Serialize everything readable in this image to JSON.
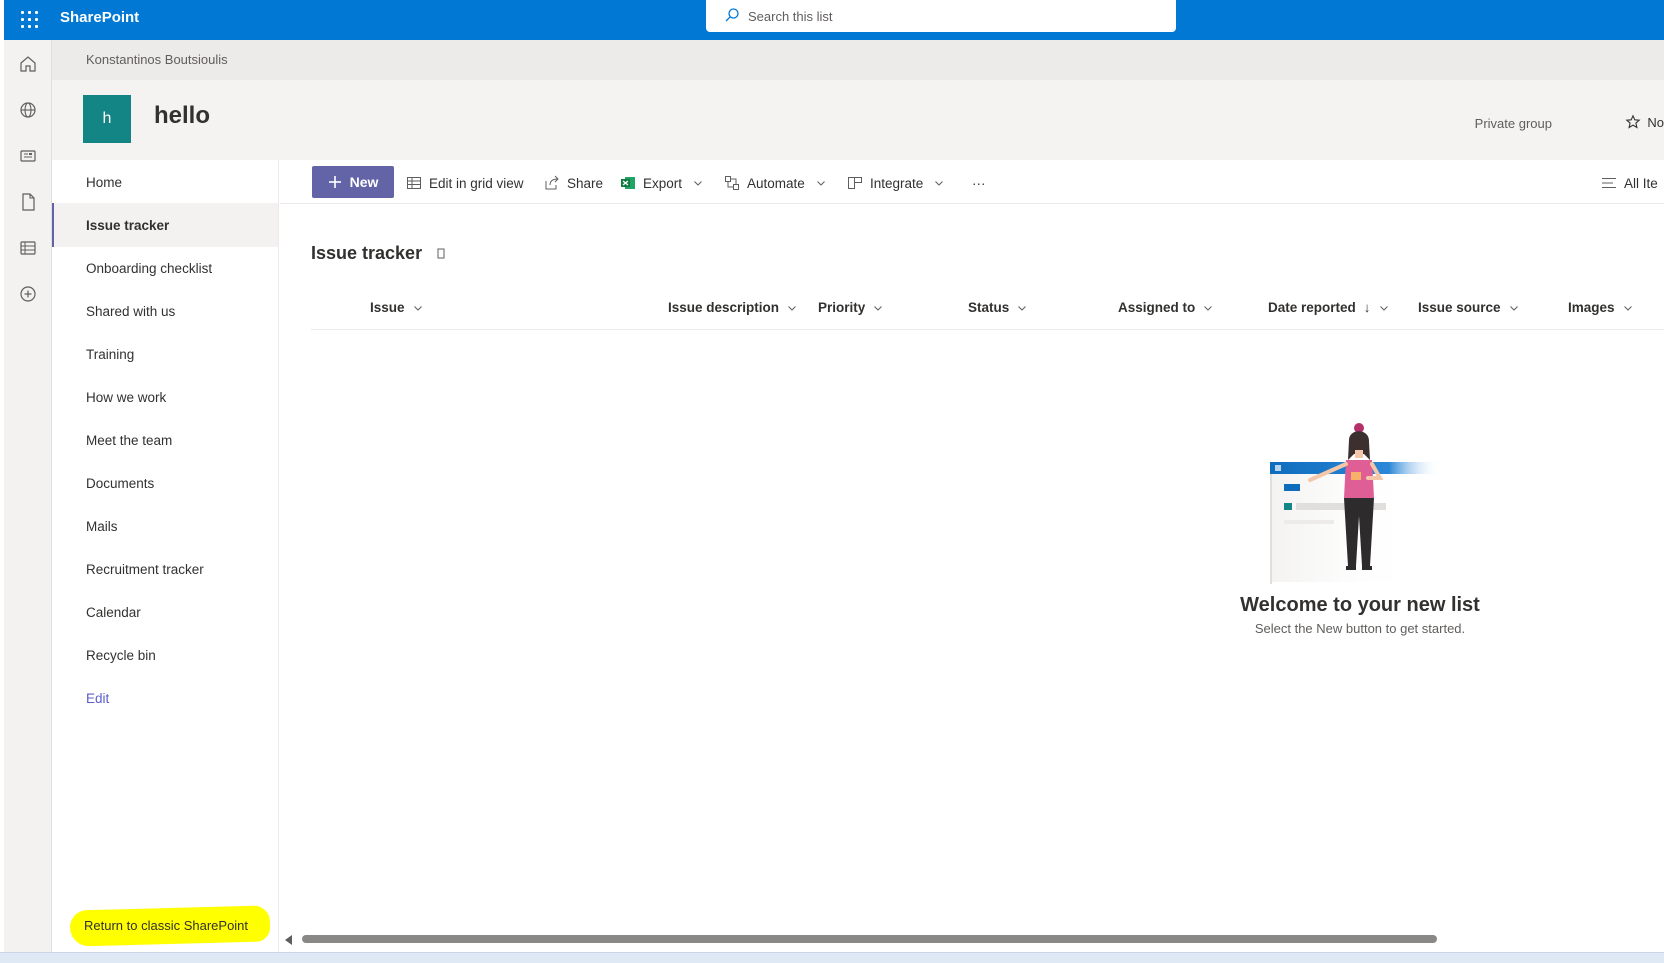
{
  "suite": {
    "brand": "SharePoint",
    "search_placeholder": "Search this list"
  },
  "breadcrumb": "Konstantinos Boutsioulis",
  "site": {
    "logo_letter": "h",
    "title": "hello",
    "privacy": "Private group",
    "follow_label": "No"
  },
  "nav": {
    "items": [
      {
        "label": "Home"
      },
      {
        "label": "Issue tracker",
        "selected": true
      },
      {
        "label": "Onboarding checklist"
      },
      {
        "label": "Shared with us"
      },
      {
        "label": "Training"
      },
      {
        "label": "How we work"
      },
      {
        "label": "Meet the team"
      },
      {
        "label": "Documents"
      },
      {
        "label": "Mails"
      },
      {
        "label": "Recruitment tracker"
      },
      {
        "label": "Calendar"
      },
      {
        "label": "Recycle bin"
      }
    ],
    "edit_label": "Edit",
    "return_classic": "Return to classic SharePoint"
  },
  "commands": {
    "new": "New",
    "edit_grid": "Edit in grid view",
    "share": "Share",
    "export": "Export",
    "automate": "Automate",
    "integrate": "Integrate",
    "more": "···",
    "view": "All Ite"
  },
  "list": {
    "title": "Issue tracker",
    "columns": [
      {
        "label": "Issue"
      },
      {
        "label": "Issue description"
      },
      {
        "label": "Priority"
      },
      {
        "label": "Status"
      },
      {
        "label": "Assigned to"
      },
      {
        "label": "Date reported",
        "sorted": "↓"
      },
      {
        "label": "Issue source"
      },
      {
        "label": "Images"
      }
    ]
  },
  "empty_state": {
    "title": "Welcome to your new list",
    "subtitle": "Select the New button to get started."
  },
  "colors": {
    "suite_bar": "#0078d4",
    "accent": "#6264a7",
    "site_logo": "#128584",
    "highlight": "#ffff00"
  }
}
